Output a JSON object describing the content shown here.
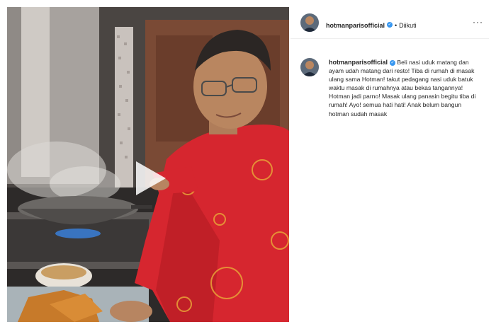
{
  "post": {
    "username": "hotmanparisofficial",
    "separator": "•",
    "follow_status": "Diikuti",
    "more_label": "···",
    "caption": "Beli nasi uduk matang dan ayam udah matang dari resto! Tiba di rumah di masak ulang sama Hotman! takut pedagang nasi uduk batuk waktu masak di rumahnya atau bekas tangannya! Hotman jadi parno! Masak ulang panasin begitu tiba di rumah! Ayo! semua hati hati! Anak belum bangun hotman sudah masak"
  },
  "icons": {
    "verified": "verified-badge-icon",
    "play": "play-icon",
    "more": "more-options-icon"
  },
  "colors": {
    "verified_blue": "#3897f0",
    "text": "#262626",
    "divider": "#efefef"
  }
}
